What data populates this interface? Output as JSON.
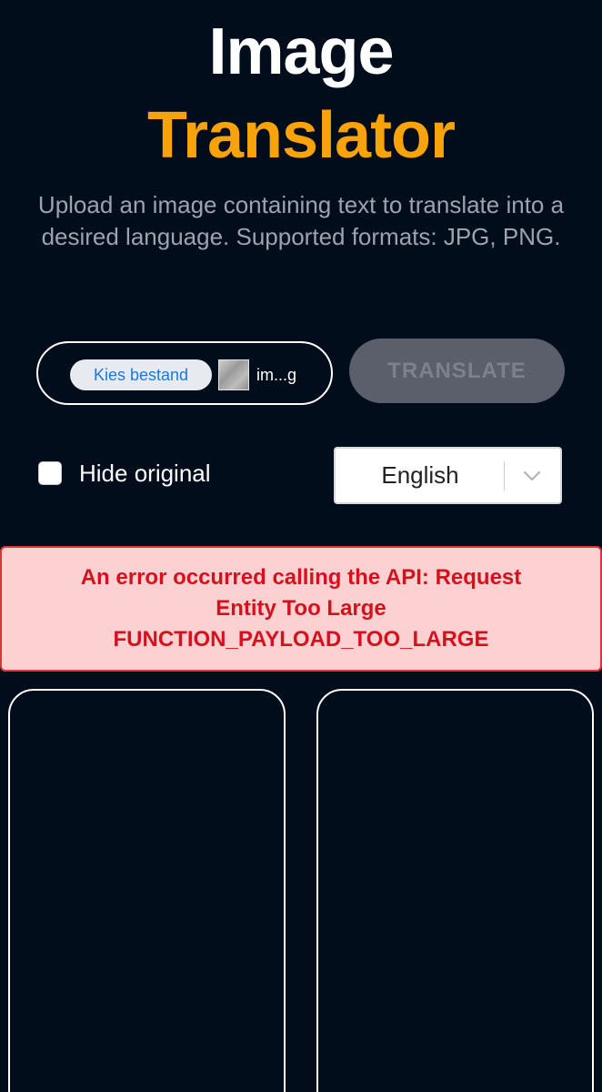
{
  "header": {
    "title_line1": "Image",
    "title_line2": "Translator",
    "subtitle": "Upload an image containing text to translate into a desired language. Supported formats: JPG, PNG."
  },
  "file_picker": {
    "button_label": "Kies bestand",
    "file_name": "im...g"
  },
  "translate_button": {
    "label": "TRANSLATE"
  },
  "options": {
    "hide_original_label": "Hide original",
    "hide_original_checked": false,
    "language_selected": "English"
  },
  "error": {
    "line1": "An error occurred calling the API: Request",
    "line2": "Entity Too Large",
    "line3": "FUNCTION_PAYLOAD_TOO_LARGE"
  },
  "colors": {
    "background": "#020d1c",
    "accent": "#f9a30b",
    "error_text": "#d4111d",
    "error_bg": "#fdd0d2"
  },
  "icons": {
    "select_chevron": "chevron-down-icon",
    "file_thumbnail": "image-thumbnail"
  }
}
